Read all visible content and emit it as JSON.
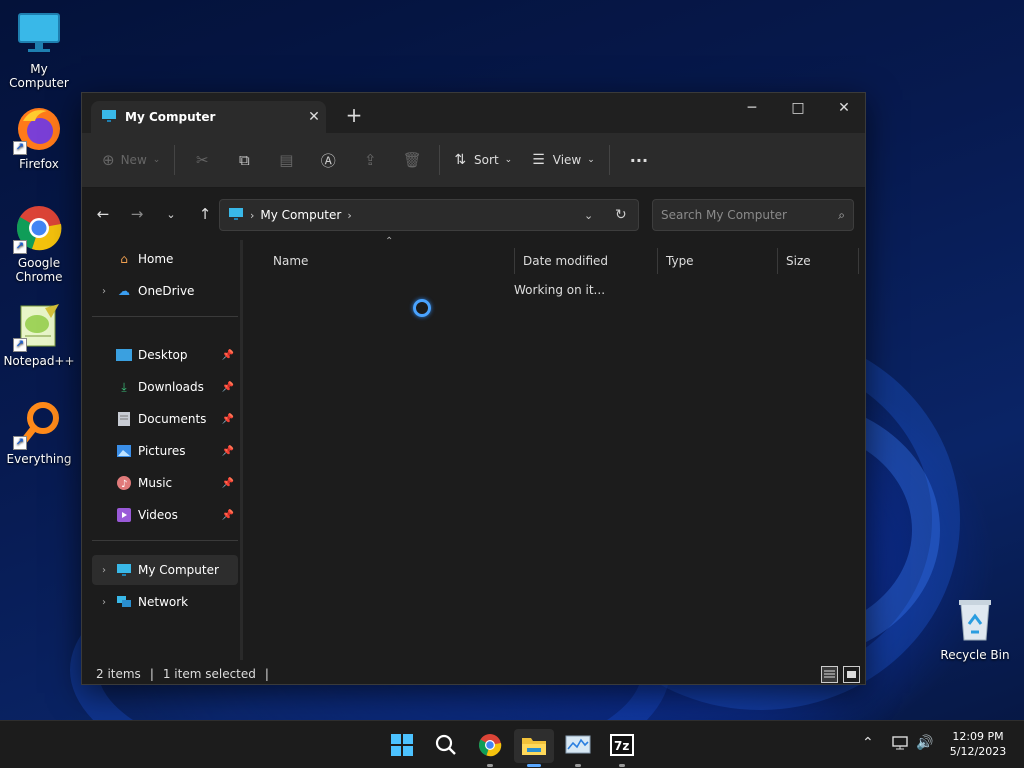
{
  "desktop": {
    "icons": [
      {
        "label": "My Computer",
        "icon": "monitor-icon"
      },
      {
        "label": "Firefox",
        "icon": "firefox-icon"
      },
      {
        "label": "Google Chrome",
        "icon": "chrome-icon"
      },
      {
        "label": "Notepad++",
        "icon": "notepadpp-icon"
      },
      {
        "label": "Everything",
        "icon": "everything-search-icon"
      },
      {
        "label": "Recycle Bin",
        "icon": "recycle-bin-icon"
      }
    ]
  },
  "window": {
    "tab_title": "My Computer",
    "new_tab": "+",
    "controls": {
      "minimize": "─",
      "maximize": "□",
      "close": "✕"
    },
    "commandbar": {
      "new_label": "New",
      "sort_label": "Sort",
      "view_label": "View",
      "more_label": "···"
    },
    "address": {
      "crumb": "My Computer"
    },
    "search": {
      "placeholder": "Search My Computer"
    },
    "nav": {
      "home": "Home",
      "onedrive": "OneDrive",
      "quick": [
        "Desktop",
        "Downloads",
        "Documents",
        "Pictures",
        "Music",
        "Videos"
      ],
      "my_computer": "My Computer",
      "network": "Network"
    },
    "columns": [
      "Name",
      "Date modified",
      "Type",
      "Size"
    ],
    "status_message": "Working on it...",
    "statusbar": {
      "items": "2 items",
      "selected": "1 item selected"
    }
  },
  "taskbar": {
    "clock_time": "12:09 PM",
    "clock_date": "5/12/2023",
    "apps": [
      "start-icon",
      "search-icon",
      "chrome-icon",
      "file-explorer-icon",
      "resource-monitor-icon",
      "7zip-icon"
    ]
  },
  "colors": {
    "accent": "#4aa3ff",
    "window_bg": "#1c1c1c",
    "cmdbar_bg": "#2b2b2b"
  }
}
